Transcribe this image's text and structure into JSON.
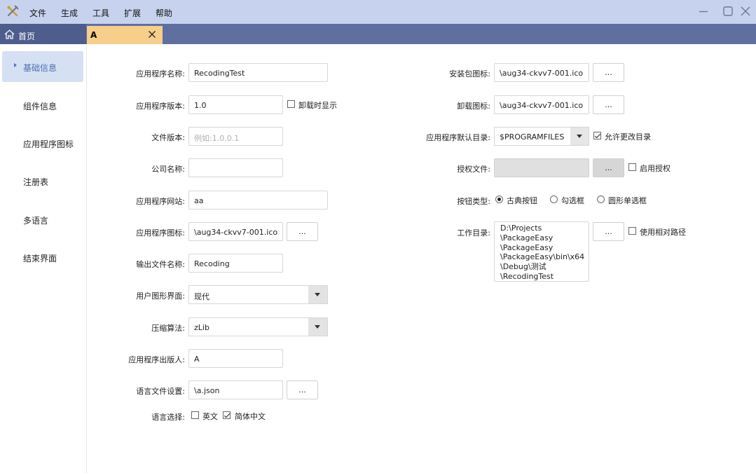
{
  "menu": {
    "items": [
      "文件",
      "生成",
      "工具",
      "扩展",
      "帮助"
    ]
  },
  "tabs": {
    "home_label": "首页",
    "doc_label": "A"
  },
  "sidebar": {
    "items": [
      {
        "label": "基础信息",
        "active": true
      },
      {
        "label": "组件信息"
      },
      {
        "label": "应用程序图标"
      },
      {
        "label": "注册表"
      },
      {
        "label": "多语言"
      },
      {
        "label": "结束界面"
      }
    ]
  },
  "form_left": {
    "app_name_label": "应用程序名称:",
    "app_name_value": "RecodingTest",
    "app_version_label": "应用程序版本:",
    "app_version_value": "1.0",
    "show_on_uninstall_label": "卸载时显示",
    "file_version_label": "文件版本:",
    "file_version_placeholder": "例如:1.0.0.1",
    "company_label": "公司名称:",
    "company_value": "",
    "website_label": "应用程序网站:",
    "website_value": "aa",
    "app_icon_label": "应用程序图标:",
    "app_icon_value": "\\aug34-ckvv7-001.ico",
    "browse_label": "...",
    "output_name_label": "输出文件名称:",
    "output_name_value": "Recoding",
    "gui_label": "用户图形界面:",
    "gui_value": "现代",
    "compression_label": "压缩算法:",
    "compression_value": "zLib",
    "publisher_label": "应用程序出版人:",
    "publisher_value": "A",
    "lang_file_label": "语言文件设置:",
    "lang_file_value": "\\a.json",
    "lang_select_label": "语言选择:",
    "lang_en_label": "英文",
    "lang_zh_label": "简体中文"
  },
  "form_right": {
    "installer_icon_label": "安装包图标:",
    "installer_icon_value": "\\aug34-ckvv7-001.ico",
    "uninstall_icon_label": "卸载图标:",
    "uninstall_icon_value": "\\aug34-ckvv7-001.ico",
    "default_dir_label": "应用程序默认目录:",
    "default_dir_value": "$PROGRAMFILES",
    "allow_change_dir_label": "允许更改目录",
    "license_file_label": "授权文件:",
    "license_file_value": "",
    "enable_license_label": "启用授权",
    "button_type_label": "按钮类型:",
    "button_type_options": [
      "古典按钮",
      "勾选框",
      "圆形单选框"
    ],
    "work_dir_label": "工作目录:",
    "work_dir_lines": [
      "D:\\Projects",
      "\\PackageEasy",
      "\\PackageEasy",
      "\\PackageEasy\\bin\\x64",
      "\\Debug\\测试",
      "\\RecodingTest"
    ],
    "use_relative_path_label": "使用相对路径",
    "browse_label": "..."
  }
}
